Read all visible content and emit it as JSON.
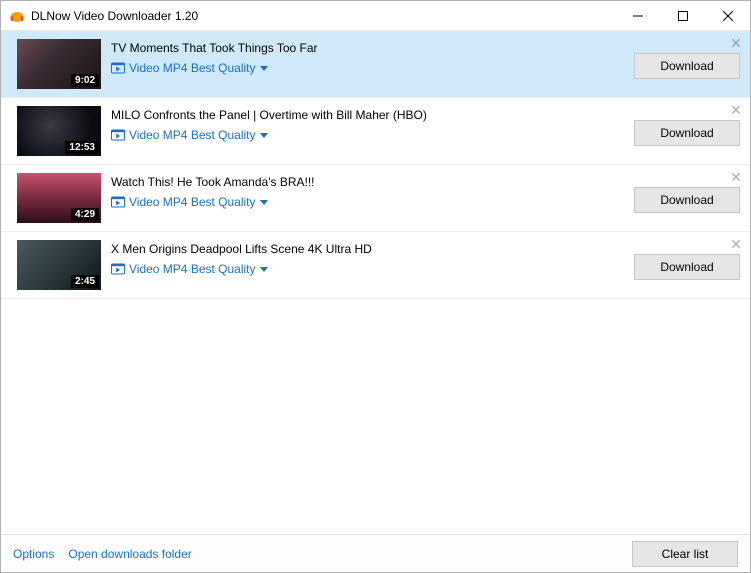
{
  "window": {
    "title": "DLNow Video Downloader 1.20"
  },
  "items": [
    {
      "title": "TV Moments That Took Things Too Far",
      "format": "Video MP4 Best Quality",
      "duration": "9:02",
      "download_label": "Download",
      "selected": true
    },
    {
      "title": "MILO Confronts the Panel | Overtime with Bill Maher (HBO)",
      "format": "Video MP4 Best Quality",
      "duration": "12:53",
      "download_label": "Download",
      "selected": false
    },
    {
      "title": "Watch This! He Took Amanda's BRA!!!",
      "format": "Video MP4 Best Quality",
      "duration": "4:29",
      "download_label": "Download",
      "selected": false
    },
    {
      "title": "X Men Origins Deadpool Lifts Scene 4K Ultra HD",
      "format": "Video MP4 Best Quality",
      "duration": "2:45",
      "download_label": "Download",
      "selected": false
    }
  ],
  "footer": {
    "options_label": "Options",
    "open_folder_label": "Open downloads folder",
    "clear_label": "Clear list"
  }
}
